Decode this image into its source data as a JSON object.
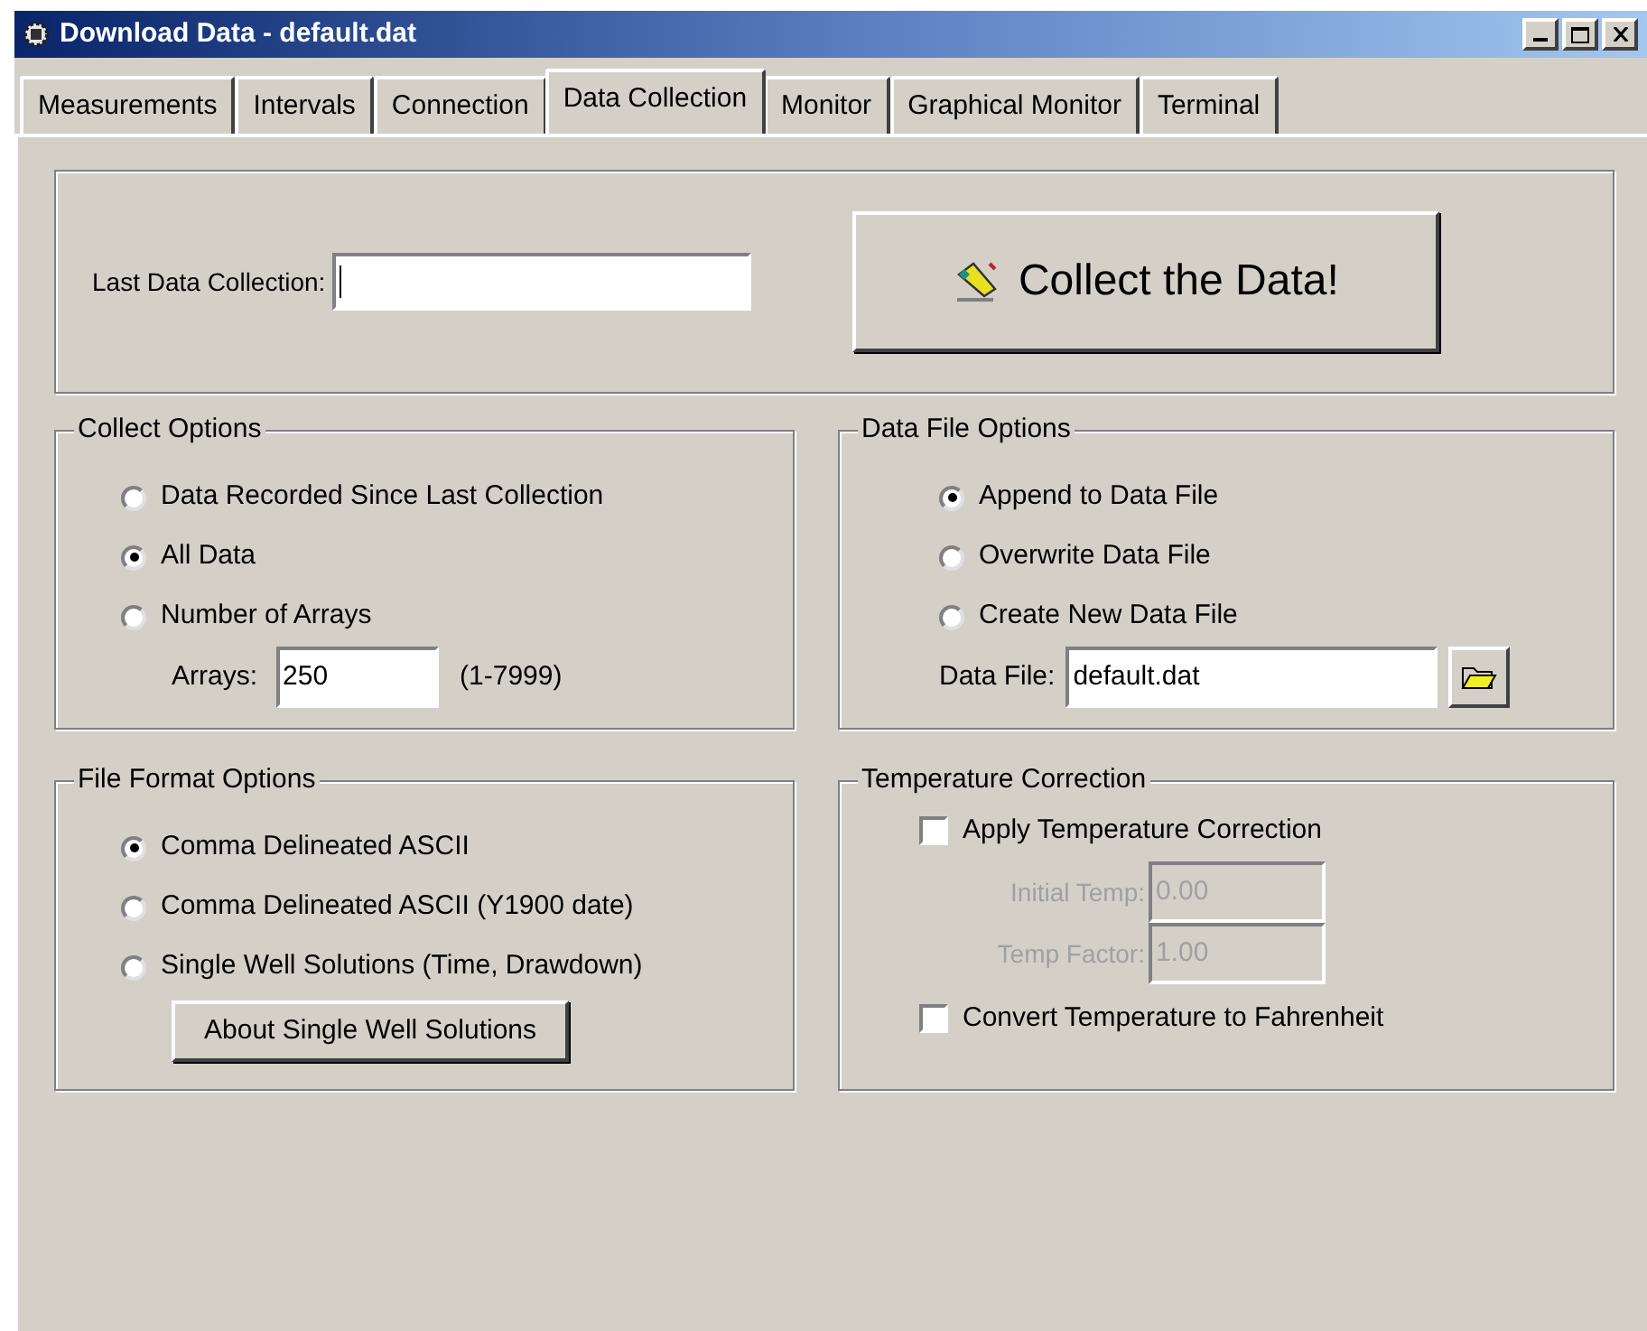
{
  "window": {
    "title": "Download Data - default.dat"
  },
  "tabs": [
    {
      "label": "Measurements",
      "selected": false
    },
    {
      "label": "Intervals",
      "selected": false
    },
    {
      "label": "Connection",
      "selected": false
    },
    {
      "label": "Data Collection",
      "selected": true
    },
    {
      "label": "Monitor",
      "selected": false
    },
    {
      "label": "Graphical Monitor",
      "selected": false
    },
    {
      "label": "Terminal",
      "selected": false
    }
  ],
  "last_collection": {
    "label": "Last Data Collection:",
    "focused": true
  },
  "collect_button": {
    "label": "Collect the Data!"
  },
  "collect_options": {
    "title": "Collect Options",
    "options": [
      {
        "label": "Data Recorded Since Last Collection",
        "selected": false
      },
      {
        "label": "All Data",
        "selected": true
      },
      {
        "label": "Number of Arrays",
        "selected": false
      }
    ],
    "arrays": {
      "label": "Arrays:",
      "value": "250",
      "range": "(1-7999)"
    }
  },
  "data_file_options": {
    "title": "Data File Options",
    "options": [
      {
        "label": "Append to Data File",
        "selected": true
      },
      {
        "label": "Overwrite Data File",
        "selected": false
      },
      {
        "label": "Create New Data File",
        "selected": false
      }
    ],
    "data_file": {
      "label": "Data File:",
      "value": "default.dat"
    }
  },
  "file_format_options": {
    "title": "File Format Options",
    "options": [
      {
        "label": "Comma Delineated ASCII",
        "selected": true
      },
      {
        "label": "Comma Delineated ASCII (Y1900 date)",
        "selected": false
      },
      {
        "label": "Single Well Solutions (Time, Drawdown)",
        "selected": false
      }
    ],
    "about_button": "About Single Well Solutions"
  },
  "temperature_correction": {
    "title": "Temperature Correction",
    "apply": {
      "label": "Apply Temperature Correction",
      "checked": false
    },
    "fields": [
      {
        "label": "Initial Temp:",
        "value": "0.00",
        "disabled": true
      },
      {
        "label": "Temp Factor:",
        "value": "1.00",
        "disabled": true
      }
    ],
    "convert": {
      "label": "Convert Temperature to Fahrenheit",
      "checked": false
    }
  }
}
